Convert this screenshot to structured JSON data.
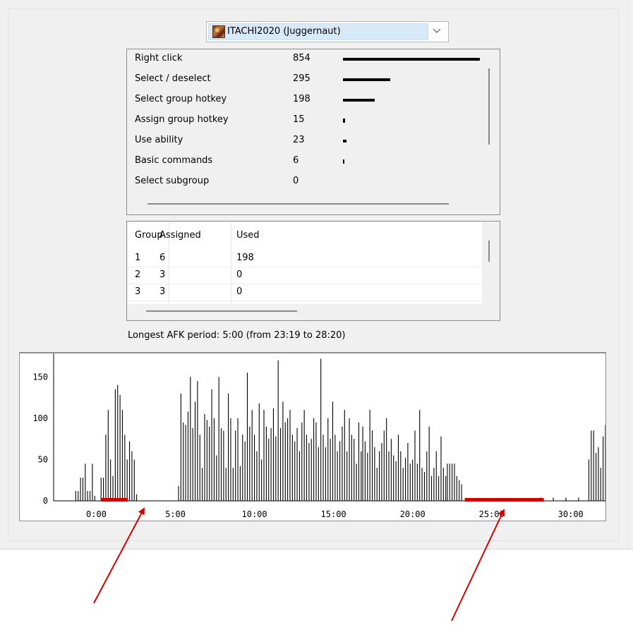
{
  "player_select": {
    "selected": "ITACHI2020 (Juggernaut)"
  },
  "actions": {
    "rows": [
      {
        "name": "Right click",
        "count": "854",
        "value": 854
      },
      {
        "name": "Select / deselect",
        "count": "295",
        "value": 295
      },
      {
        "name": "Select group hotkey",
        "count": "198",
        "value": 198
      },
      {
        "name": "Assign group hotkey",
        "count": "15",
        "value": 15
      },
      {
        "name": "Use ability",
        "count": "23",
        "value": 23
      },
      {
        "name": "Basic commands",
        "count": "6",
        "value": 6
      },
      {
        "name": "Select subgroup",
        "count": "0",
        "value": 0
      }
    ]
  },
  "groups": {
    "headers": [
      "Group",
      "Assigned",
      "Used"
    ],
    "rows": [
      [
        "1",
        "6",
        "198"
      ],
      [
        "2",
        "3",
        "0"
      ],
      [
        "3",
        "3",
        "0"
      ]
    ]
  },
  "afk_label": "Longest AFK period: 5:00 (from 23:19 to 28:20)",
  "colors": {
    "afk_highlight": "#cc0000",
    "arrow": "#d40000",
    "bar": "#000000"
  },
  "chart_data": {
    "type": "bar",
    "x_unit": "minutes",
    "x_ticks": [
      "0:00",
      "5:00",
      "10:00",
      "15:00",
      "20:00",
      "25:00",
      "30:00"
    ],
    "x_tick_values": [
      0,
      5,
      10,
      15,
      20,
      25,
      30
    ],
    "y_ticks": [
      "0",
      "50",
      "100",
      "150"
    ],
    "y_tick_values": [
      0,
      50,
      100,
      150
    ],
    "ylim": [
      0,
      175
    ],
    "xlim": [
      -2.7,
      32.2
    ],
    "afk_periods": [
      [
        0.3,
        2.0
      ],
      [
        23.3,
        28.3
      ]
    ],
    "series": [
      {
        "points": [
          [
            -1.3,
            12
          ],
          [
            -1.15,
            12
          ],
          [
            -1.0,
            28
          ],
          [
            -0.85,
            28
          ],
          [
            -0.7,
            45
          ],
          [
            -0.55,
            12
          ],
          [
            -0.4,
            12
          ],
          [
            -0.25,
            45
          ],
          [
            -0.1,
            6
          ],
          [
            0.3,
            28
          ],
          [
            0.45,
            28
          ],
          [
            0.6,
            80
          ],
          [
            0.75,
            110
          ],
          [
            0.9,
            50
          ],
          [
            1.05,
            30
          ],
          [
            1.2,
            135
          ],
          [
            1.35,
            140
          ],
          [
            1.5,
            128
          ],
          [
            1.65,
            110
          ],
          [
            1.8,
            80
          ],
          [
            1.95,
            50
          ],
          [
            2.1,
            72
          ],
          [
            2.25,
            60
          ],
          [
            2.4,
            50
          ],
          [
            2.55,
            8
          ],
          [
            5.2,
            18
          ],
          [
            5.35,
            130
          ],
          [
            5.5,
            95
          ],
          [
            5.65,
            92
          ],
          [
            5.8,
            108
          ],
          [
            5.95,
            150
          ],
          [
            6.1,
            88
          ],
          [
            6.25,
            120
          ],
          [
            6.4,
            145
          ],
          [
            6.55,
            80
          ],
          [
            6.7,
            40
          ],
          [
            6.85,
            105
          ],
          [
            7.0,
            98
          ],
          [
            7.15,
            90
          ],
          [
            7.3,
            135
          ],
          [
            7.45,
            100
          ],
          [
            7.6,
            55
          ],
          [
            7.75,
            150
          ],
          [
            7.9,
            88
          ],
          [
            8.05,
            85
          ],
          [
            8.2,
            40
          ],
          [
            8.35,
            130
          ],
          [
            8.5,
            100
          ],
          [
            8.65,
            40
          ],
          [
            8.8,
            85
          ],
          [
            8.95,
            100
          ],
          [
            9.1,
            42
          ],
          [
            9.25,
            80
          ],
          [
            9.4,
            72
          ],
          [
            9.55,
            155
          ],
          [
            9.7,
            90
          ],
          [
            9.85,
            110
          ],
          [
            10.0,
            80
          ],
          [
            10.15,
            60
          ],
          [
            10.3,
            118
          ],
          [
            10.45,
            50
          ],
          [
            10.6,
            110
          ],
          [
            10.75,
            90
          ],
          [
            10.9,
            75
          ],
          [
            11.05,
            88
          ],
          [
            11.2,
            112
          ],
          [
            11.35,
            78
          ],
          [
            11.5,
            170
          ],
          [
            11.65,
            88
          ],
          [
            11.8,
            120
          ],
          [
            11.95,
            95
          ],
          [
            12.1,
            100
          ],
          [
            12.25,
            110
          ],
          [
            12.4,
            80
          ],
          [
            12.55,
            72
          ],
          [
            12.7,
            88
          ],
          [
            12.85,
            60
          ],
          [
            13.0,
            95
          ],
          [
            13.15,
            110
          ],
          [
            13.3,
            80
          ],
          [
            13.45,
            70
          ],
          [
            13.6,
            75
          ],
          [
            13.75,
            100
          ],
          [
            13.9,
            95
          ],
          [
            14.05,
            65
          ],
          [
            14.2,
            172
          ],
          [
            14.35,
            80
          ],
          [
            14.5,
            65
          ],
          [
            14.65,
            100
          ],
          [
            14.8,
            75
          ],
          [
            14.95,
            120
          ],
          [
            15.1,
            80
          ],
          [
            15.25,
            60
          ],
          [
            15.4,
            72
          ],
          [
            15.55,
            90
          ],
          [
            15.7,
            110
          ],
          [
            15.85,
            60
          ],
          [
            16.0,
            100
          ],
          [
            16.15,
            80
          ],
          [
            16.3,
            75
          ],
          [
            16.45,
            45
          ],
          [
            16.6,
            95
          ],
          [
            16.75,
            60
          ],
          [
            16.85,
            90
          ],
          [
            17.0,
            72
          ],
          [
            17.15,
            58
          ],
          [
            17.3,
            110
          ],
          [
            17.45,
            85
          ],
          [
            17.6,
            65
          ],
          [
            17.75,
            40
          ],
          [
            17.9,
            60
          ],
          [
            18.05,
            70
          ],
          [
            18.2,
            85
          ],
          [
            18.35,
            100
          ],
          [
            18.5,
            60
          ],
          [
            18.65,
            75
          ],
          [
            18.8,
            55
          ],
          [
            18.95,
            48
          ],
          [
            19.1,
            80
          ],
          [
            19.25,
            60
          ],
          [
            19.4,
            40
          ],
          [
            19.55,
            52
          ],
          [
            19.7,
            70
          ],
          [
            19.85,
            45
          ],
          [
            20.0,
            50
          ],
          [
            20.15,
            85
          ],
          [
            20.3,
            45
          ],
          [
            20.45,
            110
          ],
          [
            20.6,
            40
          ],
          [
            20.75,
            35
          ],
          [
            20.9,
            60
          ],
          [
            21.05,
            90
          ],
          [
            21.2,
            30
          ],
          [
            21.35,
            40
          ],
          [
            21.5,
            60
          ],
          [
            21.65,
            30
          ],
          [
            21.8,
            78
          ],
          [
            21.95,
            40
          ],
          [
            22.1,
            30
          ],
          [
            22.2,
            45
          ],
          [
            22.35,
            45
          ],
          [
            22.5,
            45
          ],
          [
            22.65,
            45
          ],
          [
            22.8,
            30
          ],
          [
            22.95,
            25
          ],
          [
            23.1,
            20
          ],
          [
            28.1,
            4
          ],
          [
            28.9,
            4
          ],
          [
            29.7,
            4
          ],
          [
            30.5,
            4
          ],
          [
            31.15,
            50
          ],
          [
            31.3,
            85
          ],
          [
            31.45,
            85
          ],
          [
            31.6,
            58
          ],
          [
            31.75,
            65
          ],
          [
            31.9,
            40
          ],
          [
            32.05,
            78
          ],
          [
            32.2,
            92
          ]
        ]
      }
    ]
  }
}
